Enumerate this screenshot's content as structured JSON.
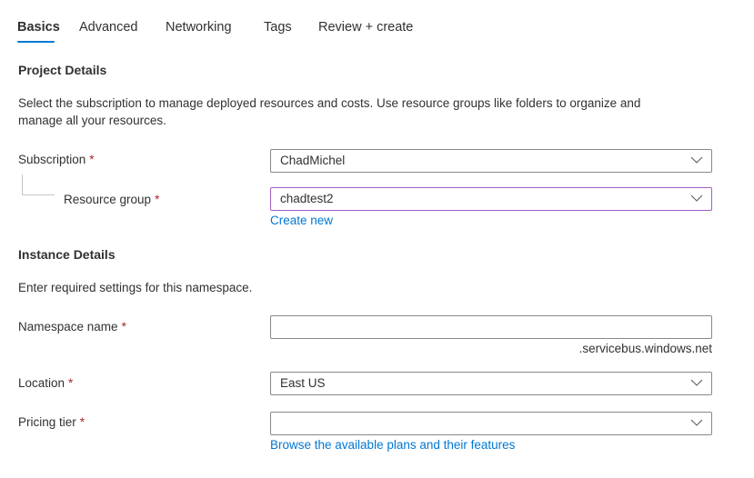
{
  "tabs": [
    {
      "label": "Basics",
      "active": true
    },
    {
      "label": "Advanced",
      "active": false
    },
    {
      "label": "Networking",
      "active": false
    },
    {
      "label": "Tags",
      "active": false
    },
    {
      "label": "Review + create",
      "active": false
    }
  ],
  "project_details": {
    "title": "Project Details",
    "description_line1": "Select the subscription to manage deployed resources and costs. Use resource groups like folders to organize and",
    "description_line2": "manage all your resources.",
    "subscription": {
      "label": "Subscription",
      "required_mark": "*",
      "value": "ChadMichel"
    },
    "resource_group": {
      "label": "Resource group",
      "required_mark": "*",
      "value": "chadtest2",
      "create_new_link": "Create new"
    }
  },
  "instance_details": {
    "title": "Instance Details",
    "description": "Enter required settings for this namespace.",
    "namespace_name": {
      "label": "Namespace name",
      "required_mark": "*",
      "value": "",
      "suffix": ".servicebus.windows.net"
    },
    "location": {
      "label": "Location",
      "required_mark": "*",
      "value": "East US"
    },
    "pricing_tier": {
      "label": "Pricing tier",
      "required_mark": "*",
      "value": "",
      "browse_link": "Browse the available plans and their features"
    }
  },
  "colors": {
    "accent": "#0078d4",
    "required": "#a4262c",
    "focus_border": "#a45fc1",
    "border": "#8a8886"
  }
}
